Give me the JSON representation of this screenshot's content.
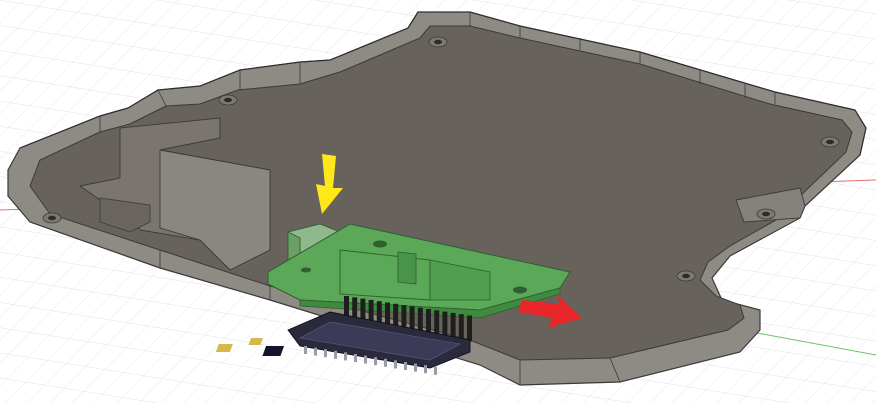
{
  "viewport": {
    "background": "#ffffff",
    "grid_color": "#dcdcdc",
    "axis_x_color": "#e07070",
    "axis_y_color": "#70c070"
  },
  "model": {
    "body_color": "#6e6a63",
    "body_top_color": "#67635c",
    "wall_color": "#8e8a84",
    "edge_color": "#3a3a3a",
    "pcb_color": "#5aa858",
    "pcb_dark_color": "#3e8a3e",
    "connector_color": "#8fb88c",
    "header_pin_color": "#1e1e1e",
    "board_color": "#2a2a3c",
    "chip_color": "#d8b84a"
  },
  "annotations": {
    "arrow_down": {
      "color": "#ffe81a",
      "icon": "arrow-down-icon"
    },
    "arrow_right": {
      "color": "#e8262a",
      "icon": "arrow-right-icon"
    }
  }
}
